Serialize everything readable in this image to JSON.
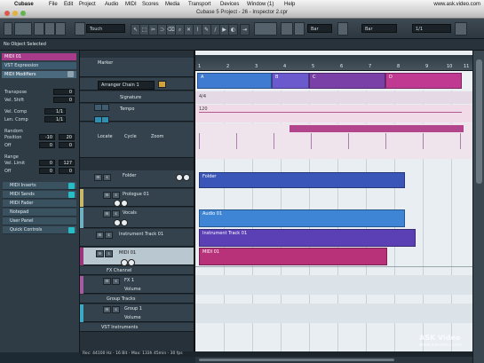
{
  "menubar": {
    "app": "Cubase",
    "items": [
      "File",
      "Edit",
      "Project",
      "Audio",
      "MIDI",
      "Scores",
      "Media",
      "Transport",
      "Devices",
      "Window (1)",
      "Help"
    ],
    "right_text": "www.ask.video.com"
  },
  "window": {
    "title": "Cubase 5 Project - 26 - Inspector 2.cpr"
  },
  "toolbar": {
    "mode": "Touch",
    "snap": "Bar",
    "quantize": "1/1"
  },
  "status": {
    "selection": "No Object Selected"
  },
  "inspector": {
    "track_name": "MIDI 01",
    "items": {
      "vst_expression": "VST Expression",
      "midi_modifiers": "MIDI Modifiers",
      "transpose": "Transpose",
      "transpose_val": "0",
      "vel_shift": "Vel. Shift",
      "vel_shift_val": "0",
      "vel_comp": "Vel. Comp",
      "vel_comp_val": "1/1",
      "len_comp": "Len. Comp",
      "len_comp_val": "1/1",
      "random": "Random",
      "position": "Position",
      "pos_min": "-10",
      "pos_max": "20",
      "off": "Off",
      "off_a": "0",
      "off_b": "0",
      "range": "Range",
      "vel_limit": "Vel. Limit",
      "range_min": "0",
      "range_max": "127",
      "off2": "Off",
      "off2_a": "0",
      "off2_b": "0"
    },
    "sections": [
      "MIDI Inserts",
      "MIDI Sends",
      "MIDI Fader",
      "Notepad",
      "User Panel",
      "Quick Controls"
    ]
  },
  "tracklist": {
    "marker": "Marker",
    "arranger": "Arranger Chain 1",
    "signature": "Signature",
    "tempo": "Tempo",
    "locate": "Locate",
    "cycle": "Cycle",
    "zoom": "Zoom",
    "tracks": [
      "Folder",
      "Prologue 01",
      "Vocals",
      "Instrument Track 01",
      "MIDI 01",
      "FX Channel",
      "FX 1",
      "Volume",
      "Group Tracks",
      "Group 1",
      "Volume",
      "VST Instruments"
    ]
  },
  "timeline": {
    "ruler": [
      "1",
      "2",
      "3",
      "4",
      "5",
      "6",
      "7",
      "8",
      "9",
      "10",
      "11"
    ],
    "arranger_events": [
      "A",
      "B",
      "C",
      "D"
    ],
    "signature_event": "4/4",
    "tempo_event": "120",
    "parts": [
      "Folder",
      "Audio 01",
      "Instrument Track 01",
      "MIDI 01"
    ]
  },
  "statusbar": {
    "text": "Rec: 44100 Hz - 16 Bit - Max: 133h 45min - 30 fps"
  },
  "watermark": {
    "brand": "ASK Video",
    "sub": "www.askvideo.com"
  },
  "colors": {
    "arranger_a": "#3f7bd0",
    "arranger_b": "#6a5acd",
    "arranger_c": "#7b3fa8",
    "arranger_d": "#c03a92",
    "folder_part": "#3b56b9",
    "audio_part": "#3f85d6",
    "instrument_part": "#5a3fb5",
    "midi_part": "#b8327a"
  }
}
